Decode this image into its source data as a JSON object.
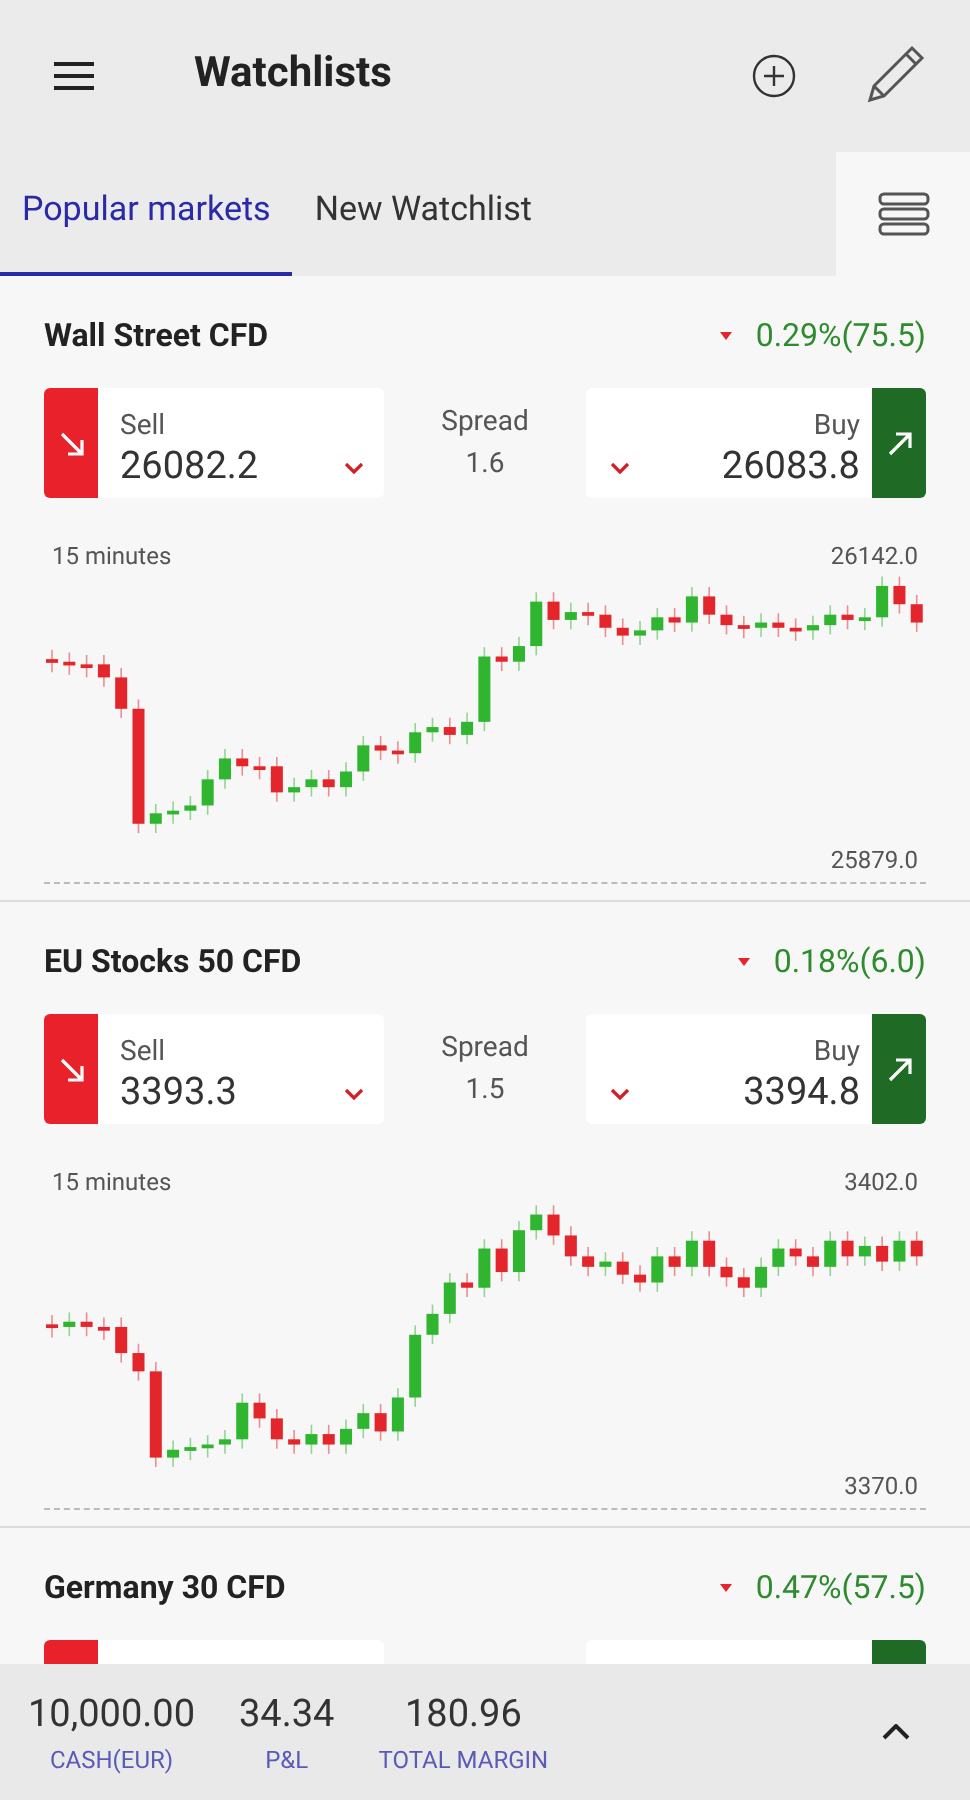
{
  "header": {
    "title": "Watchlists"
  },
  "tabs": [
    {
      "label": "Popular markets",
      "selected": true
    },
    {
      "label": "New Watchlist",
      "selected": false
    }
  ],
  "markets": [
    {
      "name": "Wall Street CFD",
      "change": "0.29%(75.5)",
      "sell_label": "Sell",
      "sell": "26082.2",
      "spread_label": "Spread",
      "spread": "1.6",
      "buy_label": "Buy",
      "buy": "26083.8",
      "timeframe": "15 minutes",
      "high": "26142.0",
      "low": "25879.0"
    },
    {
      "name": "EU Stocks 50 CFD",
      "change": "0.18%(6.0)",
      "sell_label": "Sell",
      "sell": "3393.3",
      "spread_label": "Spread",
      "spread": "1.5",
      "buy_label": "Buy",
      "buy": "3394.8",
      "timeframe": "15 minutes",
      "high": "3402.0",
      "low": "3370.0"
    },
    {
      "name": "Germany 30 CFD",
      "change": "0.47%(57.5)"
    }
  ],
  "summary": [
    {
      "value": "10,000.00",
      "label": "CASH(EUR)"
    },
    {
      "value": "34.34",
      "label": "P&L"
    },
    {
      "value": "180.96",
      "label": "TOTAL MARGIN"
    }
  ]
}
